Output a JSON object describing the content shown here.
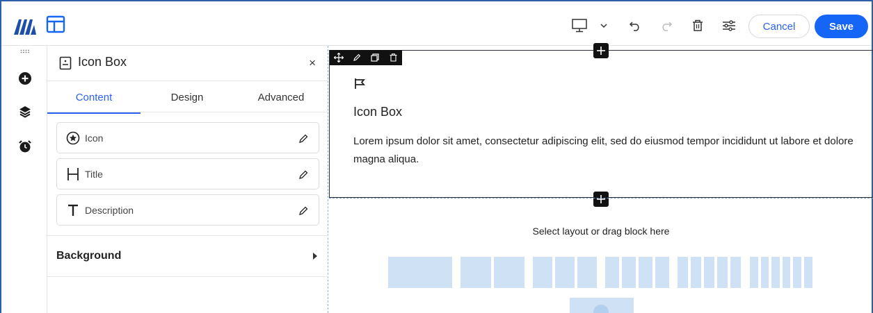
{
  "toolbar": {
    "cancel_label": "Cancel",
    "save_label": "Save",
    "device": "desktop"
  },
  "panel": {
    "title": "Icon Box",
    "close_label": "×",
    "tabs": [
      {
        "label": "Content",
        "active": true
      },
      {
        "label": "Design",
        "active": false
      },
      {
        "label": "Advanced",
        "active": false
      }
    ],
    "rows": [
      {
        "label": "Icon",
        "icon": "star-circle-icon"
      },
      {
        "label": "Title",
        "icon": "heading-icon"
      },
      {
        "label": "Description",
        "icon": "text-icon"
      }
    ],
    "background_label": "Background"
  },
  "canvas": {
    "block": {
      "title": "Icon Box",
      "description": "Lorem ipsum dolor sit amet, consectetur adipiscing elit, sed do eiusmod tempor incididunt ut labore et dolore magna aliqua.",
      "icon": "flag-icon"
    },
    "empty_label": "Select layout or drag block here",
    "layout_options": [
      1,
      2,
      3,
      4,
      5,
      6
    ]
  },
  "colors": {
    "accent": "#1565f7",
    "frame": "#2d5fa8",
    "placeholder": "#cfe1f5"
  }
}
